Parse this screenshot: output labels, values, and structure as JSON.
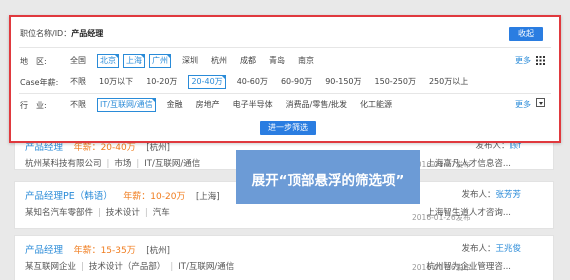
{
  "filter": {
    "position_label": "职位名称/ID：",
    "position_value": "产品经理",
    "collapse_label": "收起",
    "location": {
      "label": "地　区:",
      "options": [
        "全国",
        "北京",
        "上海",
        "广州",
        "深圳",
        "杭州",
        "成都",
        "青岛",
        "南京"
      ],
      "selected": [
        "北京",
        "上海",
        "广州"
      ],
      "more": "更多"
    },
    "salary": {
      "label": "Case年薪:",
      "options": [
        "不限",
        "10万以下",
        "10-20万",
        "20-40万",
        "40-60万",
        "60-90万",
        "90-150万",
        "150-250万",
        "250万以上"
      ],
      "selected": [
        "20-40万"
      ]
    },
    "industry": {
      "label": "行　业:",
      "options": [
        "不限",
        "IT/互联网/通信",
        "金融",
        "房地产",
        "电子半导体",
        "消费品/零售/批发",
        "化工能源"
      ],
      "selected": [
        "IT/互联网/通信"
      ],
      "more": "更多"
    },
    "submit_label": "进一步筛选"
  },
  "callout_text": "展开“顶部悬浮的筛选项”",
  "jobs": [
    {
      "title": "产品经理",
      "salary": "年薪：20-40万",
      "city": "[杭州]",
      "company": "杭州某科技有限公司",
      "dept": "市场",
      "industry": "IT/互联网/通信",
      "date": "2016-01-27发布",
      "publisher_label": "发布人：",
      "publisher": "顾f",
      "publisher_company": "上海高凡人才信息咨..."
    },
    {
      "title": "产品经理PE（韩语）",
      "salary": "年薪：10-20万",
      "city": "[上海]",
      "company": "某知名汽车零部件",
      "dept": "技术设计",
      "industry": "汽车",
      "date": "2016-01-26发布",
      "publisher_label": "发布人：",
      "publisher": "张芳芳",
      "publisher_company": "上海智生道人才咨询..."
    },
    {
      "title": "产品经理",
      "salary": "年薪：15-35万",
      "city": "[杭州]",
      "company": "某互联网企业",
      "dept": "技术设计（产品部）",
      "industry": "IT/互联网/通信",
      "date": "2016-01-26发布",
      "publisher_label": "发布人：",
      "publisher": "王兆俊",
      "publisher_company": "杭州智为企业管理咨..."
    }
  ],
  "colors": {
    "accent": "#2a7de1",
    "highlight_border": "#e0393e",
    "salary": "#f07c1e",
    "callout": "#6c9bd6"
  }
}
